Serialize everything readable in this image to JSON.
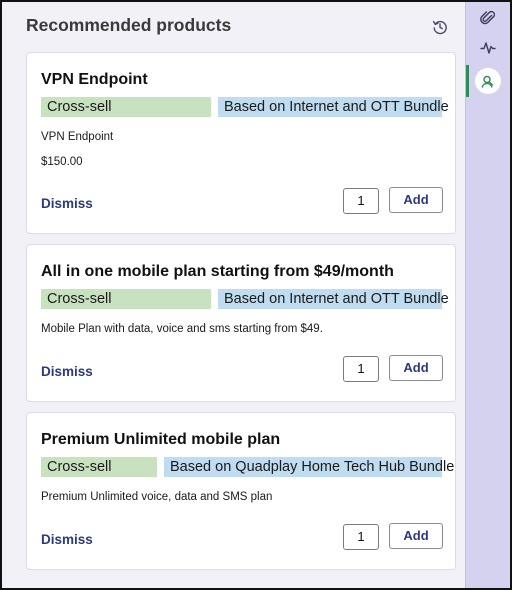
{
  "panel": {
    "title": "Recommended products",
    "history_icon": "history-icon"
  },
  "products": [
    {
      "title": "VPN Endpoint",
      "tag_type": "Cross-sell",
      "tag_basis": "Based on Internet and OTT Bundle",
      "description": "VPN Endpoint",
      "price": "$150.00",
      "dismiss_label": "Dismiss",
      "quantity": "1",
      "add_label": "Add"
    },
    {
      "title": "All in one mobile plan starting from $49/month",
      "tag_type": "Cross-sell",
      "tag_basis": "Based on Internet and OTT Bundle",
      "description": "Mobile Plan with data, voice and sms starting from $49.",
      "dismiss_label": "Dismiss",
      "quantity": "1",
      "add_label": "Add"
    },
    {
      "title": "Premium Unlimited mobile plan",
      "tag_type": "Cross-sell",
      "tag_basis": "Based on Quadplay Home Tech Hub Bundle",
      "description": "Premium Unlimited voice, data and SMS plan",
      "dismiss_label": "Dismiss",
      "quantity": "1",
      "add_label": "Add"
    }
  ],
  "rail": {
    "items": [
      "paperclip-icon",
      "activity-icon",
      "recommendation-icon"
    ],
    "active": "recommendation-icon"
  },
  "colors": {
    "tag_green": "#c8e2c0",
    "tag_blue": "#bfdcf0",
    "link": "#2c3a7e",
    "rail_bg": "#d4d2ef",
    "active_accent": "#2f8a5c"
  }
}
